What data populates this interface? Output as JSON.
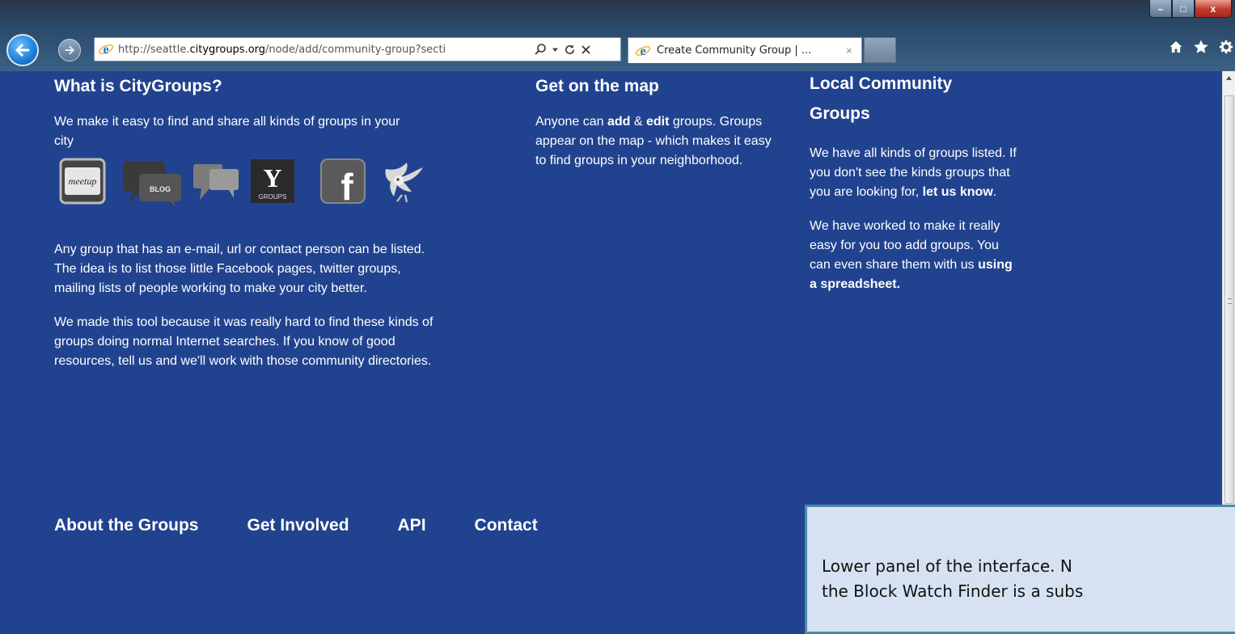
{
  "browser": {
    "url_prefix": "http://seattle.",
    "url_domain": "citygroups.org",
    "url_suffix": "/node/add/community-group?secti",
    "tab_title": "Create Community Group | ...",
    "tab_close": "×",
    "window_min": "–",
    "window_max": "□",
    "window_close": "x"
  },
  "col1": {
    "heading": "What is CityGroups?",
    "lead": "We make it easy to find and share all kinds of groups in your city",
    "icons": [
      "meetup-icon",
      "blog-icon",
      "chat-bubbles-icon",
      "yahoo-groups-icon",
      "facebook-icon",
      "twitter-bird-icon"
    ],
    "meetup_label": "meetup",
    "blog_label": "BLOG",
    "yahoo_letter": "Y",
    "yahoo_label": "GROUPS",
    "facebook_letter": "f",
    "p2": "Any group that has an e-mail, url or contact person can be listed. The idea is to list those little Facebook pages, twitter groups, mailing lists of people working to make your city better.",
    "p3": "We made this tool because it was really hard to find these kinds of groups doing normal Internet searches. If you know of good resources, tell us and we'll work with those community directories."
  },
  "col2": {
    "heading": "Get on the map",
    "text_1": "Anyone can ",
    "add_link": "add",
    "text_2": " & ",
    "edit_link": "edit",
    "text_3": " groups. Groups appear on the map - which makes it easy to find groups in your neighborhood."
  },
  "col3": {
    "heading": "Local Community Groups",
    "p1_text": "We have all kinds of groups listed. If you don't see the kinds groups that you are looking for, ",
    "p1_link": "let us know",
    "p1_end": ".",
    "p2_text": "We have worked to make it really easy for you too add groups. You can even share them with us ",
    "p2_link": "using a spreadsheet."
  },
  "footer": {
    "links": [
      "About the Groups",
      "Get Involved",
      "API",
      "Contact"
    ]
  },
  "callout": {
    "line1": "Lower panel of the interface.  N",
    "line2": "the Block Watch Finder is a subs"
  }
}
